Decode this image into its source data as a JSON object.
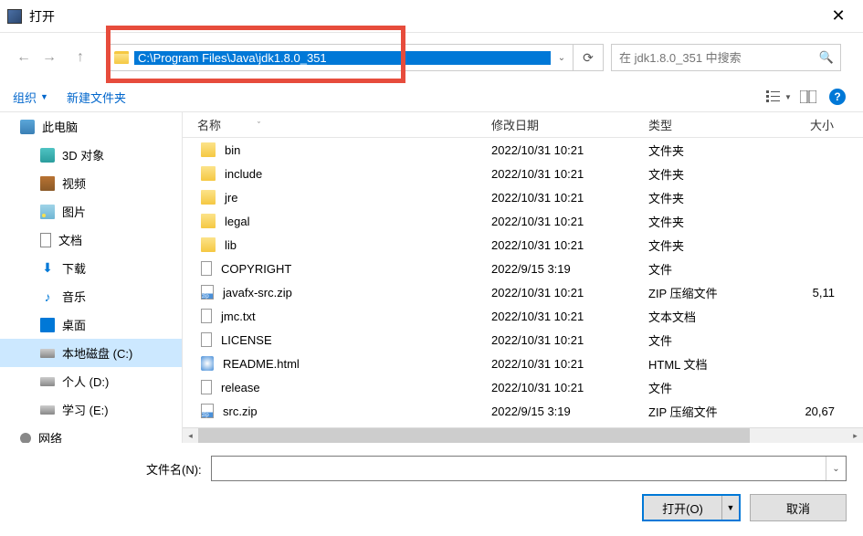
{
  "title": "打开",
  "address": "C:\\Program Files\\Java\\jdk1.8.0_351",
  "search_placeholder": "在 jdk1.8.0_351 中搜索",
  "toolbar": {
    "organize": "组织",
    "new_folder": "新建文件夹"
  },
  "sidebar": [
    {
      "icon": "ico-pc",
      "label": "此电脑",
      "level": 0
    },
    {
      "icon": "ico-3d",
      "label": "3D 对象",
      "level": 1
    },
    {
      "icon": "ico-video",
      "label": "视频",
      "level": 1
    },
    {
      "icon": "ico-pic",
      "label": "图片",
      "level": 1
    },
    {
      "icon": "ico-doc",
      "label": "文档",
      "level": 1
    },
    {
      "icon": "ico-dl",
      "label": "下载",
      "level": 1,
      "glyph": "⬇"
    },
    {
      "icon": "ico-music",
      "label": "音乐",
      "level": 1,
      "glyph": "♪"
    },
    {
      "icon": "ico-desktop",
      "label": "桌面",
      "level": 1
    },
    {
      "icon": "ico-disk",
      "label": "本地磁盘 (C:)",
      "level": 1,
      "selected": true
    },
    {
      "icon": "ico-disk",
      "label": "个人 (D:)",
      "level": 1
    },
    {
      "icon": "ico-disk",
      "label": "学习 (E:)",
      "level": 1
    },
    {
      "icon": "ico-net",
      "label": "网络",
      "level": 0
    }
  ],
  "columns": {
    "name": "名称",
    "date": "修改日期",
    "type": "类型",
    "size": "大小"
  },
  "files": [
    {
      "icon": "fi-folder",
      "name": "bin",
      "date": "2022/10/31 10:21",
      "type": "文件夹",
      "size": ""
    },
    {
      "icon": "fi-folder",
      "name": "include",
      "date": "2022/10/31 10:21",
      "type": "文件夹",
      "size": ""
    },
    {
      "icon": "fi-folder",
      "name": "jre",
      "date": "2022/10/31 10:21",
      "type": "文件夹",
      "size": ""
    },
    {
      "icon": "fi-folder",
      "name": "legal",
      "date": "2022/10/31 10:21",
      "type": "文件夹",
      "size": ""
    },
    {
      "icon": "fi-folder",
      "name": "lib",
      "date": "2022/10/31 10:21",
      "type": "文件夹",
      "size": ""
    },
    {
      "icon": "fi-file",
      "name": "COPYRIGHT",
      "date": "2022/9/15 3:19",
      "type": "文件",
      "size": ""
    },
    {
      "icon": "fi-zip",
      "name": "javafx-src.zip",
      "date": "2022/10/31 10:21",
      "type": "ZIP 压缩文件",
      "size": "5,11"
    },
    {
      "icon": "fi-txt",
      "name": "jmc.txt",
      "date": "2022/10/31 10:21",
      "type": "文本文档",
      "size": ""
    },
    {
      "icon": "fi-file",
      "name": "LICENSE",
      "date": "2022/10/31 10:21",
      "type": "文件",
      "size": ""
    },
    {
      "icon": "fi-html",
      "name": "README.html",
      "date": "2022/10/31 10:21",
      "type": "HTML 文档",
      "size": ""
    },
    {
      "icon": "fi-file",
      "name": "release",
      "date": "2022/10/31 10:21",
      "type": "文件",
      "size": ""
    },
    {
      "icon": "fi-zip",
      "name": "src.zip",
      "date": "2022/9/15 3:19",
      "type": "ZIP 压缩文件",
      "size": "20,67"
    }
  ],
  "filename_label": "文件名(N):",
  "buttons": {
    "open": "打开(O)",
    "cancel": "取消"
  }
}
